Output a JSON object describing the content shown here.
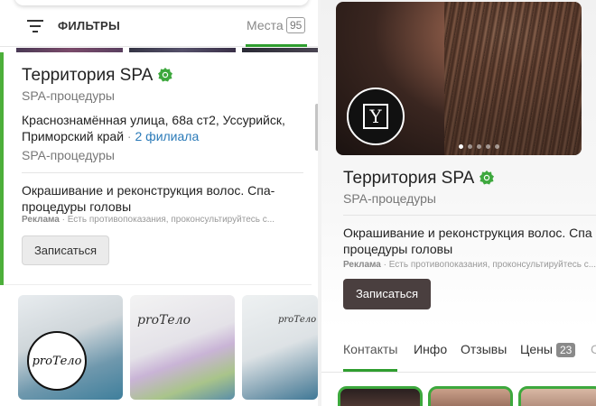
{
  "left_panel": {
    "filter_label": "ФИЛЬТРЫ",
    "places_label": "Места",
    "places_count": "95",
    "card": {
      "title": "Территория SPA",
      "category": "SPA-процедуры",
      "address": "Краснознамённая улица, 68а ст2, Уссурийск, Приморский край",
      "separator": " · ",
      "branches": "2 филиала",
      "category2": "SPA-процедуры",
      "description": "Окрашивание и реконструкция волос. Спа-процедуры головы",
      "ad_label": "Реклама",
      "ad_text": " · Есть противопоказания, проконсультируйтесь с...",
      "button": "Записаться"
    },
    "photos": {
      "logo_text": "proТело",
      "script_text": "proТело"
    }
  },
  "right_panel": {
    "hero_logo_letter": "Y",
    "hero_dots": 5,
    "hero_active_dot": 0,
    "title": "Территория SPA",
    "category": "SPA-процедуры",
    "description_line1": "Окрашивание и реконструкция волос. Спа",
    "description_line2": "процедуры головы",
    "ad_label": "Реклама",
    "ad_text": " · Есть противопоказания, проконсультируйтесь с...",
    "button": "Записаться",
    "tabs": [
      {
        "label": "Контакты",
        "active": true
      },
      {
        "label": "Инфо"
      },
      {
        "label": "Отзывы"
      },
      {
        "label": "Цены",
        "badge": "23"
      },
      {
        "label": "С"
      }
    ]
  },
  "colors": {
    "accent_green": "#2f9e2f",
    "verified_green": "#3da83d",
    "link_blue": "#2a7ab8",
    "primary_button": "#4a3f3f"
  }
}
